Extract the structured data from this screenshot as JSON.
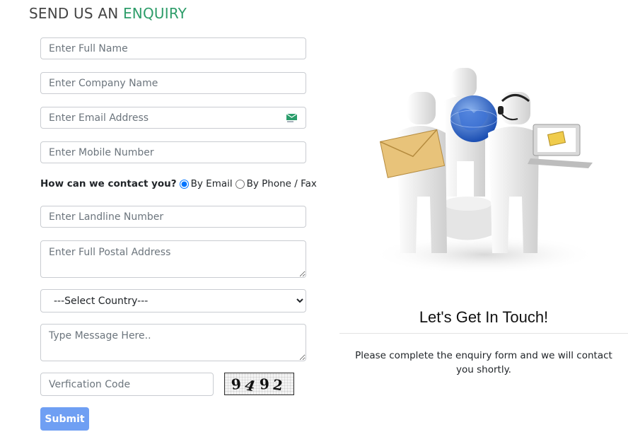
{
  "heading": {
    "part1": "SEND US AN ",
    "part2": "ENQUIRY"
  },
  "form": {
    "full_name_placeholder": "Enter Full Name",
    "company_placeholder": "Enter Company Name",
    "email_placeholder": "Enter Email Address",
    "mobile_placeholder": "Enter Mobile Number",
    "contact_question": "How can we contact you?",
    "contact_options": [
      {
        "label": "By Email",
        "checked": true
      },
      {
        "label": "By Phone / Fax",
        "checked": false
      }
    ],
    "landline_placeholder": "Enter Landline Number",
    "postal_placeholder": "Enter Full Postal Address",
    "country_select": {
      "selected": "---Select Country---"
    },
    "message_placeholder": "Type Message Here..",
    "verification_placeholder": "Verfication Code",
    "captcha_digits": [
      "9",
      "4",
      "9",
      "2"
    ],
    "submit_label": "Submit"
  },
  "info": {
    "title": "Let's Get In Touch!",
    "text": "Please complete the enquiry form and we will contact you shortly."
  },
  "colors": {
    "accent": "#2e9d6a",
    "submit": "#6f9ff3"
  }
}
